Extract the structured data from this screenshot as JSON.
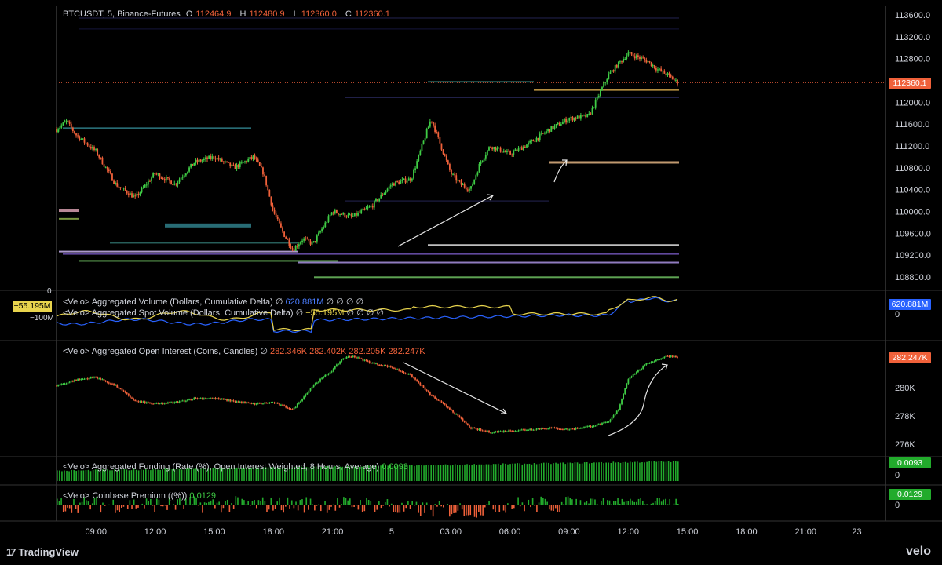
{
  "header": {
    "symbol": "BTCUSDT, 5, Binance-Futures",
    "o_label": "O",
    "o_value": "112464.9",
    "h_label": "H",
    "h_value": "112480.9",
    "l_label": "L",
    "l_value": "112360.0",
    "c_label": "C",
    "c_value": "112360.1"
  },
  "price_badge": "112360.1",
  "colors": {
    "up": "#26a69a",
    "upbright": "#3fcc45",
    "down": "#f0613a",
    "blue": "#2962ff",
    "yellow": "#e8d44d",
    "bg": "#000000"
  },
  "panes": {
    "volume": {
      "title1": "<Velo> Aggregated Volume (Dollars, Cumulative Delta)",
      "value1": "620.881M",
      "nulls1": "∅ ∅ ∅ ∅",
      "title2": "<Velo> Aggregated Spot Volume (Dollars, Cumulative Delta)",
      "value2": "−55.195M",
      "nulls2": "∅ ∅ ∅ ∅",
      "left_badge": "−55.195M",
      "left_tick": "−100M",
      "left_zero": "0",
      "right_badge": "620.881M",
      "right_zero": "0"
    },
    "oi": {
      "title": "<Velo> Aggregated Open Interest (Coins, Candles)",
      "v1": "282.346K",
      "v2": "282.402K",
      "v3": "282.205K",
      "v4": "282.247K",
      "badge": "282.247K",
      "ticks": [
        "280K",
        "278K",
        "276K"
      ]
    },
    "funding": {
      "title": "<Velo> Aggregated Funding (Rate (%), Open Interest Weighted, 8 Hours, Average)",
      "value": "0.0093",
      "badge": "0.0093",
      "zero": "0"
    },
    "premium": {
      "title": "<Velo> Coinbase Premium ((%))",
      "value": "0.0129",
      "badge": "0.0129",
      "zero": "0"
    }
  },
  "null_symbol": "∅",
  "branding": {
    "tradingview": "TradingView",
    "velo": "velo"
  },
  "chart_data": {
    "type": "line",
    "title": "BTCUSDT, 5, Binance-Futures",
    "x_ticks": [
      "09:00",
      "12:00",
      "15:00",
      "18:00",
      "21:00",
      "5",
      "03:00",
      "06:00",
      "09:00",
      "12:00",
      "15:00",
      "18:00",
      "21:00",
      "23"
    ],
    "y_ticks": [
      113600,
      113200,
      112800,
      112400,
      112000,
      111600,
      111200,
      110800,
      110400,
      110000,
      109600,
      109200,
      108800
    ],
    "ylim": [
      108600,
      113700
    ],
    "series": [
      {
        "name": "BTCUSDT",
        "x_hours": [
          7,
          7.5,
          8,
          9,
          10,
          11,
          12,
          13,
          14,
          15,
          16,
          17,
          17.5,
          18,
          18.5,
          19,
          19.5,
          20,
          21,
          22,
          23,
          24,
          25,
          26,
          27,
          27.5,
          28,
          28.5,
          29,
          30,
          31,
          32,
          33,
          34,
          35,
          36,
          37,
          37.5,
          38,
          38.5
        ],
        "values": [
          111500,
          111650,
          111400,
          111100,
          110500,
          110250,
          110700,
          110500,
          110900,
          111000,
          110800,
          111000,
          110700,
          110000,
          109600,
          109300,
          109500,
          109400,
          110000,
          109900,
          110100,
          110500,
          110600,
          111700,
          110700,
          110500,
          110400,
          110900,
          111200,
          111050,
          111250,
          111500,
          111700,
          111750,
          112500,
          112900,
          112750,
          112600,
          112500,
          112360
        ]
      }
    ],
    "open_interest": {
      "name": "<Velo> Aggregated Open Interest (Coins, Candles)",
      "ylim": [
        275600,
        283000
      ],
      "y_ticks": [
        280000,
        278000,
        276000
      ],
      "x_hours": [
        7,
        8,
        9,
        10,
        11,
        12,
        13,
        14,
        15,
        16,
        17,
        18,
        19,
        20,
        21,
        21.5,
        22,
        23,
        24,
        25,
        26,
        27,
        28,
        29,
        30,
        31,
        32,
        33,
        34,
        35,
        35.5,
        36,
        37,
        38,
        38.5
      ],
      "values": [
        280200,
        280600,
        280800,
        280200,
        279100,
        278900,
        279000,
        279300,
        279300,
        279100,
        278900,
        279000,
        278500,
        280200,
        281300,
        282100,
        282300,
        281800,
        281500,
        280900,
        279500,
        278500,
        277200,
        276900,
        277000,
        277100,
        277200,
        277100,
        277300,
        277600,
        278500,
        280700,
        281800,
        282300,
        282247
      ]
    }
  }
}
